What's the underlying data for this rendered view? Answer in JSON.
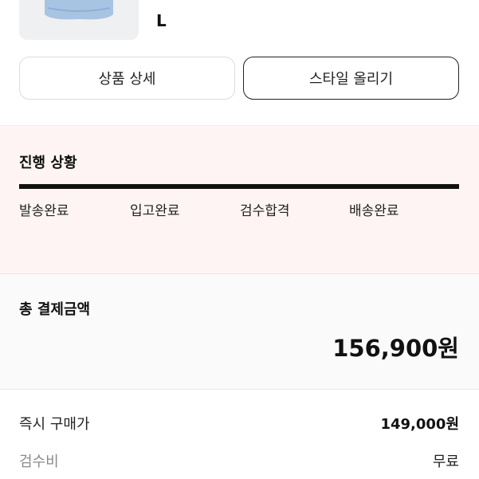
{
  "product": {
    "size": "L"
  },
  "actions": {
    "detail_label": "상품 상세",
    "style_label": "스타일 올리기"
  },
  "progress": {
    "title": "진행 상황",
    "steps": [
      "발송완료",
      "입고완료",
      "검수합격",
      "배송완료"
    ],
    "completion": 1.0
  },
  "payment": {
    "title": "총 결제금액",
    "amount": "156,900원"
  },
  "price_rows": [
    {
      "label": "즉시 구매가",
      "value": "149,000원"
    },
    {
      "label": "검수비",
      "value": "무료"
    }
  ],
  "colors": {
    "progress_bg": "#fdf4f3",
    "accent": "#111111",
    "product": "#a9c3e3"
  }
}
